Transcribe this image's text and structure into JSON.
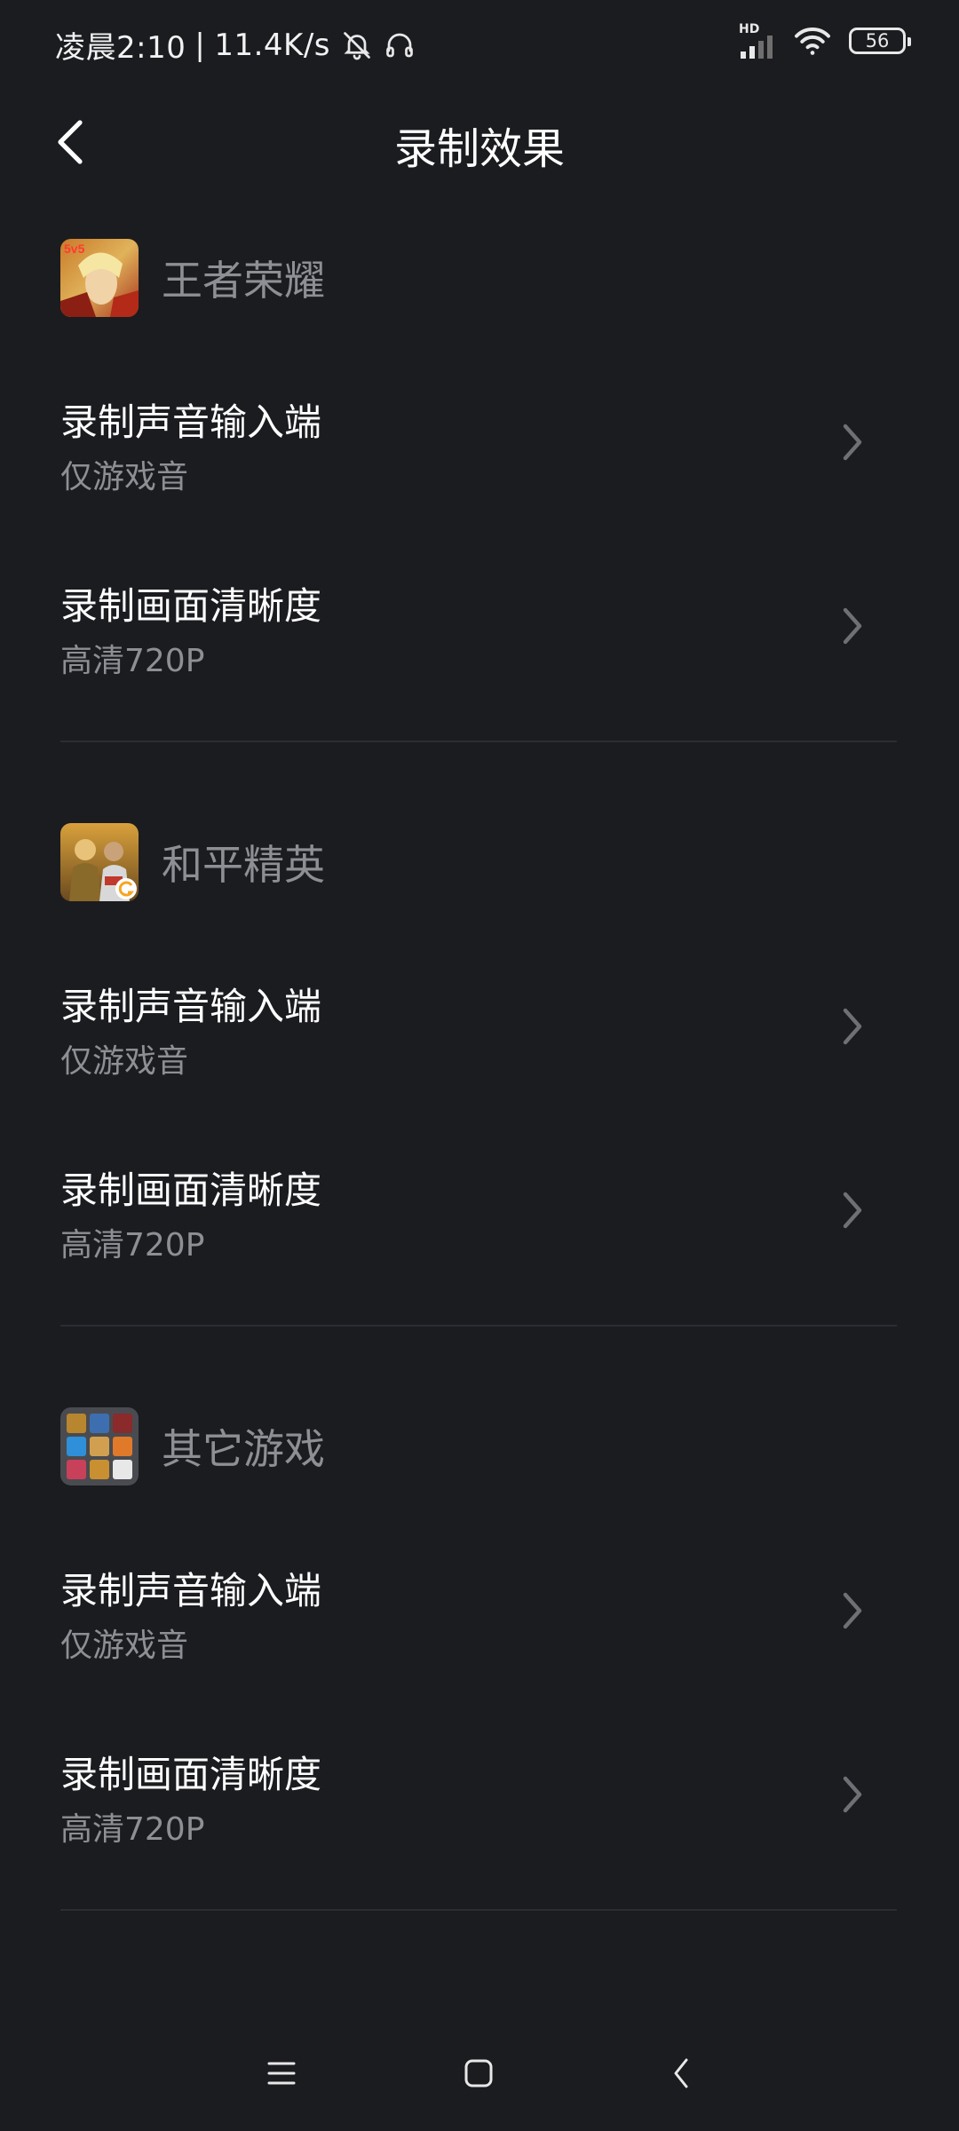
{
  "status_bar": {
    "time": "凌晨2:10",
    "separator": "|",
    "net_speed": "11.4K/s",
    "hd_label": "HD",
    "battery_level": "56",
    "icons": [
      "bell-mute-icon",
      "headset-icon",
      "signal-icon",
      "wifi-icon",
      "battery-icon"
    ]
  },
  "header": {
    "title": "录制效果",
    "back_icon": "chevron-left-icon"
  },
  "sections": [
    {
      "game": "王者荣耀",
      "rows": [
        {
          "title": "录制声音输入端",
          "value": "仅游戏音"
        },
        {
          "title": "录制画面清晰度",
          "value": "高清720P"
        }
      ]
    },
    {
      "game": "和平精英",
      "rows": [
        {
          "title": "录制声音输入端",
          "value": "仅游戏音"
        },
        {
          "title": "录制画面清晰度",
          "value": "高清720P"
        }
      ]
    },
    {
      "game": "其它游戏",
      "rows": [
        {
          "title": "录制声音输入端",
          "value": "仅游戏音"
        },
        {
          "title": "录制画面清晰度",
          "value": "高清720P"
        }
      ]
    }
  ],
  "game_icon_badge": "5v5",
  "colors": {
    "background": "#1b1c20",
    "primary_text": "#ffffff",
    "secondary_text": "#8e8f94",
    "divider": "#2c2d32",
    "chevron": "#6f7075"
  },
  "nav_bar": {
    "icons": [
      "menu-icon",
      "home-icon",
      "back-icon"
    ]
  }
}
